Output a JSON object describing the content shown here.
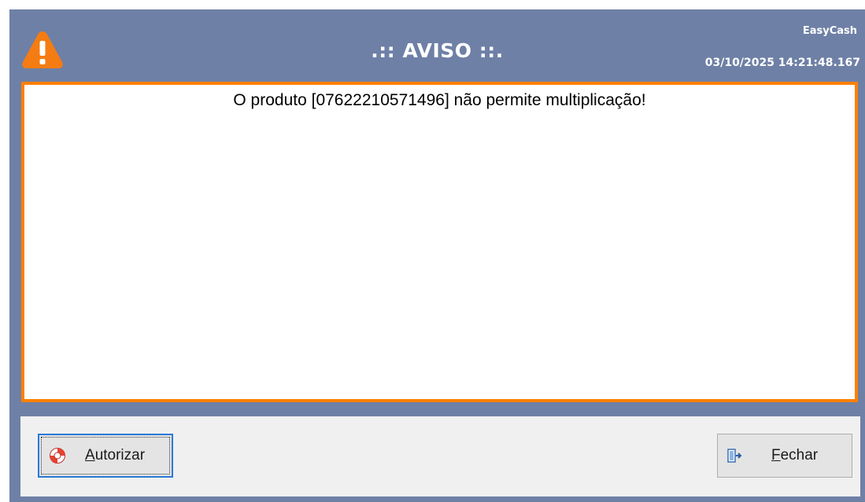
{
  "window": {
    "title": ".:: AVISO ::.",
    "app_name": "EasyCash",
    "timestamp": "03/10/2025 14:21:48.167",
    "icon": "warning-icon"
  },
  "message": {
    "text": "O produto [07622210571496] não permite multiplicação!"
  },
  "buttons": {
    "autorizar": {
      "mnemonic": "A",
      "rest": "utorizar",
      "icon": "lifebuoy-icon"
    },
    "fechar": {
      "mnemonic": "F",
      "rest": "echar",
      "icon": "exit-door-icon"
    }
  },
  "colors": {
    "header_bg": "#6e80a6",
    "border_accent": "#ff8000",
    "focus_border": "#2a78d7"
  }
}
